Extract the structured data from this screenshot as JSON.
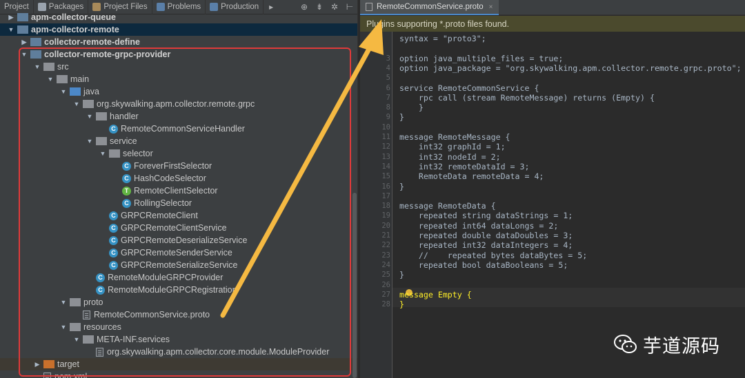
{
  "left_toolbar": {
    "tabs": [
      {
        "label": "Project",
        "icon": "project-icon"
      },
      {
        "label": "Packages",
        "icon": "packages-icon"
      },
      {
        "label": "Project Files",
        "icon": "project-files-icon"
      },
      {
        "label": "Problems",
        "icon": "problems-icon"
      },
      {
        "label": "Production",
        "icon": "production-icon"
      }
    ],
    "more_glyph": "▸",
    "tools": [
      "⊕",
      "⇟",
      "✲",
      "⊢"
    ]
  },
  "tree": [
    {
      "label": "apm-collector-queue",
      "icon": "module",
      "arrow": "▶",
      "indent": 0,
      "bold": true
    },
    {
      "label": "apm-collector-remote",
      "icon": "module",
      "arrow": "▼",
      "indent": 0,
      "bold": true,
      "state": "selected"
    },
    {
      "label": "collector-remote-define",
      "icon": "module",
      "arrow": "▶",
      "indent": 1,
      "bold": true
    },
    {
      "label": "collector-remote-grpc-provider",
      "icon": "module",
      "arrow": "▼",
      "indent": 1,
      "bold": true
    },
    {
      "label": "src",
      "icon": "folder-grey",
      "arrow": "▼",
      "indent": 2
    },
    {
      "label": "main",
      "icon": "folder-grey",
      "arrow": "▼",
      "indent": 3
    },
    {
      "label": "java",
      "icon": "folder-blue",
      "arrow": "▼",
      "indent": 4
    },
    {
      "label": "org.skywalking.apm.collector.remote.grpc",
      "icon": "folder-grey",
      "arrow": "▼",
      "indent": 5
    },
    {
      "label": "handler",
      "icon": "folder-grey",
      "arrow": "▼",
      "indent": 6
    },
    {
      "label": "RemoteCommonServiceHandler",
      "icon": "class",
      "arrow": "",
      "indent": 7
    },
    {
      "label": "service",
      "icon": "folder-grey",
      "arrow": "▼",
      "indent": 6
    },
    {
      "label": "selector",
      "icon": "folder-grey",
      "arrow": "▼",
      "indent": 7
    },
    {
      "label": "ForeverFirstSelector",
      "icon": "class",
      "arrow": "",
      "indent": 8
    },
    {
      "label": "HashCodeSelector",
      "icon": "class",
      "arrow": "",
      "indent": 8
    },
    {
      "label": "RemoteClientSelector",
      "icon": "interface",
      "arrow": "",
      "indent": 8
    },
    {
      "label": "RollingSelector",
      "icon": "class",
      "arrow": "",
      "indent": 8
    },
    {
      "label": "GRPCRemoteClient",
      "icon": "class",
      "arrow": "",
      "indent": 7
    },
    {
      "label": "GRPCRemoteClientService",
      "icon": "class",
      "arrow": "",
      "indent": 7
    },
    {
      "label": "GRPCRemoteDeserializeService",
      "icon": "class",
      "arrow": "",
      "indent": 7
    },
    {
      "label": "GRPCRemoteSenderService",
      "icon": "class",
      "arrow": "",
      "indent": 7
    },
    {
      "label": "GRPCRemoteSerializeService",
      "icon": "class",
      "arrow": "",
      "indent": 7
    },
    {
      "label": "RemoteModuleGRPCProvider",
      "icon": "class",
      "arrow": "",
      "indent": 6
    },
    {
      "label": "RemoteModuleGRPCRegistration",
      "icon": "class",
      "arrow": "",
      "indent": 6
    },
    {
      "label": "proto",
      "icon": "folder-grey",
      "arrow": "▼",
      "indent": 4
    },
    {
      "label": "RemoteCommonService.proto",
      "icon": "file",
      "arrow": "",
      "indent": 5
    },
    {
      "label": "resources",
      "icon": "folder-grey",
      "arrow": "▼",
      "indent": 4
    },
    {
      "label": "META-INF.services",
      "icon": "folder-grey",
      "arrow": "▼",
      "indent": 5
    },
    {
      "label": "org.skywalking.apm.collector.core.module.ModuleProvider",
      "icon": "file",
      "arrow": "",
      "indent": 6
    },
    {
      "label": "target",
      "icon": "folder-orange",
      "arrow": "▶",
      "indent": 2,
      "state": "highlight"
    },
    {
      "label": "pom.xml",
      "icon": "file",
      "arrow": "",
      "indent": 2
    }
  ],
  "editor": {
    "tab_label": "RemoteCommonService.proto",
    "tab_close": "×",
    "banner": "Plugins supporting *.proto files found.",
    "lines": [
      {
        "n": "",
        "text": "syntax = \"proto3\";"
      },
      {
        "n": "",
        "text": ""
      },
      {
        "n": "3",
        "text": "option java_multiple_files = true;"
      },
      {
        "n": "4",
        "text": "option java_package = \"org.skywalking.apm.collector.remote.grpc.proto\";"
      },
      {
        "n": "5",
        "text": ""
      },
      {
        "n": "6",
        "text": "service RemoteCommonService {"
      },
      {
        "n": "7",
        "text": "    rpc call (stream RemoteMessage) returns (Empty) {"
      },
      {
        "n": "8",
        "text": "    }"
      },
      {
        "n": "9",
        "text": "}"
      },
      {
        "n": "10",
        "text": ""
      },
      {
        "n": "11",
        "text": "message RemoteMessage {"
      },
      {
        "n": "12",
        "text": "    int32 graphId = 1;"
      },
      {
        "n": "13",
        "text": "    int32 nodeId = 2;"
      },
      {
        "n": "14",
        "text": "    int32 remoteDataId = 3;"
      },
      {
        "n": "15",
        "text": "    RemoteData remoteData = 4;"
      },
      {
        "n": "16",
        "text": "}"
      },
      {
        "n": "17",
        "text": ""
      },
      {
        "n": "18",
        "text": "message RemoteData {"
      },
      {
        "n": "19",
        "text": "    repeated string dataStrings = 1;"
      },
      {
        "n": "20",
        "text": "    repeated int64 dataLongs = 2;"
      },
      {
        "n": "21",
        "text": "    repeated double dataDoubles = 3;"
      },
      {
        "n": "22",
        "text": "    repeated int32 dataIntegers = 4;"
      },
      {
        "n": "23",
        "text": "    //    repeated bytes dataBytes = 5;"
      },
      {
        "n": "24",
        "text": "    repeated bool dataBooleans = 5;"
      },
      {
        "n": "25",
        "text": "}"
      },
      {
        "n": "26",
        "text": ""
      },
      {
        "n": "27",
        "text": "message Empty {"
      },
      {
        "n": "28",
        "text": "}"
      }
    ]
  },
  "watermark": {
    "text": "芋道源码",
    "icon": "wechat-icon"
  },
  "colors": {
    "highlight_box": "#e03a3a",
    "arrow": "#f5b942",
    "selection": "#0d293e",
    "banner": "#4b4a2d"
  }
}
